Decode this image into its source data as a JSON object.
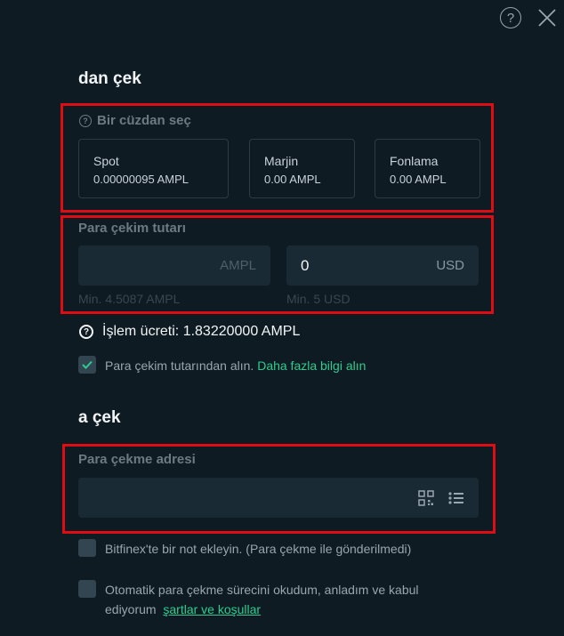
{
  "header": {
    "help_label": "?"
  },
  "withdraw_from": {
    "title": "dan çek",
    "wallet_label": "Bir cüzdan seç",
    "wallets": [
      {
        "name": "Spot",
        "balance": "0.00000095 AMPL"
      },
      {
        "name": "Marjin",
        "balance": "0.00 AMPL"
      },
      {
        "name": "Fonlama",
        "balance": "0.00 AMPL"
      }
    ],
    "amount_label": "Para çekim tutarı",
    "amount_ampl": {
      "value": "",
      "unit": "AMPL",
      "min": "Min. 4.5087 AMPL"
    },
    "amount_usd": {
      "value": "0",
      "unit": "USD",
      "min": "Min. 5 USD"
    },
    "fee_icon": "?",
    "fee_text": "İşlem ücreti: 1.83220000 AMPL",
    "deduct_checkbox": {
      "checked": true,
      "label": "Para çekim tutarından alın.",
      "link": "Daha fazla bilgi alın"
    }
  },
  "withdraw_to": {
    "title": "a çek",
    "address_label": "Para çekme adresi",
    "address_value": "",
    "note_checkbox": {
      "checked": false,
      "label": "Bitfinex'te bir not ekleyin. (Para çekme ile gönderilmedi)"
    },
    "terms_checkbox": {
      "checked": false,
      "label": "Otomatik para çekme sürecini okudum, anladım ve kabul ediyorum",
      "link": "şartlar ve koşullar"
    }
  },
  "colors": {
    "background": "#0e1b22",
    "input": "#1a2a35",
    "accent_green": "#2ecc8f",
    "highlight_red": "#e00c13"
  }
}
